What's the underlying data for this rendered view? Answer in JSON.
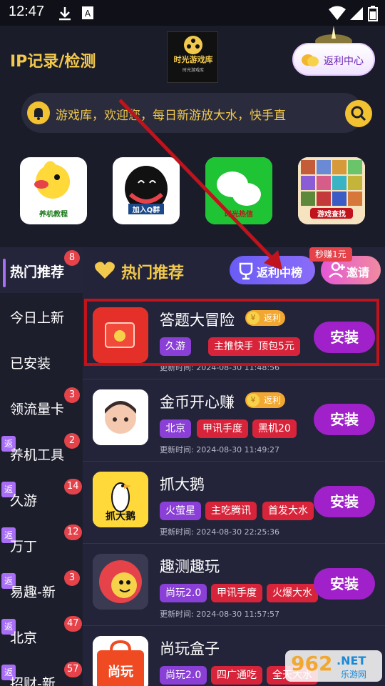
{
  "status_bar": {
    "time": "12:47"
  },
  "header": {
    "title": "IP记录/检测",
    "logo_text": "时光游戏库",
    "logo_subtext": "时光游戏库",
    "rebate_center_label": "返利中心",
    "notice_text": "游戏库，欢迎您，每日新游放大水，快手直",
    "shortcuts": [
      {
        "label": "养机教程"
      },
      {
        "label": "加入Q群"
      },
      {
        "label": "时光热信"
      },
      {
        "label": "游戏查找"
      }
    ]
  },
  "sidebar": {
    "items": [
      {
        "label": "热门推荐",
        "badge": "8",
        "rebate": "",
        "active": true
      },
      {
        "label": "今日上新",
        "badge": "",
        "rebate": ""
      },
      {
        "label": "已安装",
        "badge": "",
        "rebate": ""
      },
      {
        "label": "领流量卡",
        "badge": "3",
        "rebate": ""
      },
      {
        "label": "养机工具",
        "badge": "2",
        "rebate": "返"
      },
      {
        "label": "久游",
        "badge": "14",
        "rebate": "返"
      },
      {
        "label": "万丁",
        "badge": "12",
        "rebate": "返"
      },
      {
        "label": "易趣-新",
        "badge": "3",
        "rebate": "返"
      },
      {
        "label": "北京",
        "badge": "47",
        "rebate": "返"
      },
      {
        "label": "招财-新",
        "badge": "57",
        "rebate": "返"
      }
    ]
  },
  "main": {
    "title": "热门推荐",
    "rank_label": "返利中榜",
    "invite_label": "邀请",
    "earn_tag": "秒赚1元",
    "install_label": "安装",
    "rebate_label": "返利",
    "yen": "¥",
    "apps": [
      {
        "name": "答题大冒险",
        "rebate": true,
        "tags": [
          "久游",
          "主推快手",
          "顶包5元"
        ],
        "update": "更新时间: 2024-08-30 11:48:56"
      },
      {
        "name": "金币开心赚",
        "rebate": true,
        "tags": [
          "北京",
          "甲讯手度",
          "黑机20"
        ],
        "update": "更新时间: 2024-08-30 11:49:27"
      },
      {
        "name": "抓大鹅",
        "rebate": false,
        "tags": [
          "火萤星",
          "主吃腾讯",
          "首发大水"
        ],
        "update": "更新时间: 2024-08-30 22:25:36"
      },
      {
        "name": "趣测趣玩",
        "rebate": false,
        "tags": [
          "尚玩2.0",
          "甲讯手度",
          "火爆大水"
        ],
        "update": "更新时间: 2024-08-30 11:57:57"
      },
      {
        "name": "尚玩盒子",
        "rebate": false,
        "tags": [
          "尚玩2.0",
          "四广通吃",
          "全天大水"
        ],
        "update": ""
      }
    ],
    "icon_texts": {
      "goose": "抓大鹅",
      "shangwan": "尚玩"
    }
  },
  "watermark": {
    "text": "962",
    "suffix": ".NET",
    "sub": "乐游网"
  },
  "colors": {
    "accent_yellow": "#f2c94c",
    "install_purple": "#a021c9",
    "tag_purple": "#8a3fd6",
    "tag_red": "#d8243a",
    "highlight": "#c0131b"
  }
}
